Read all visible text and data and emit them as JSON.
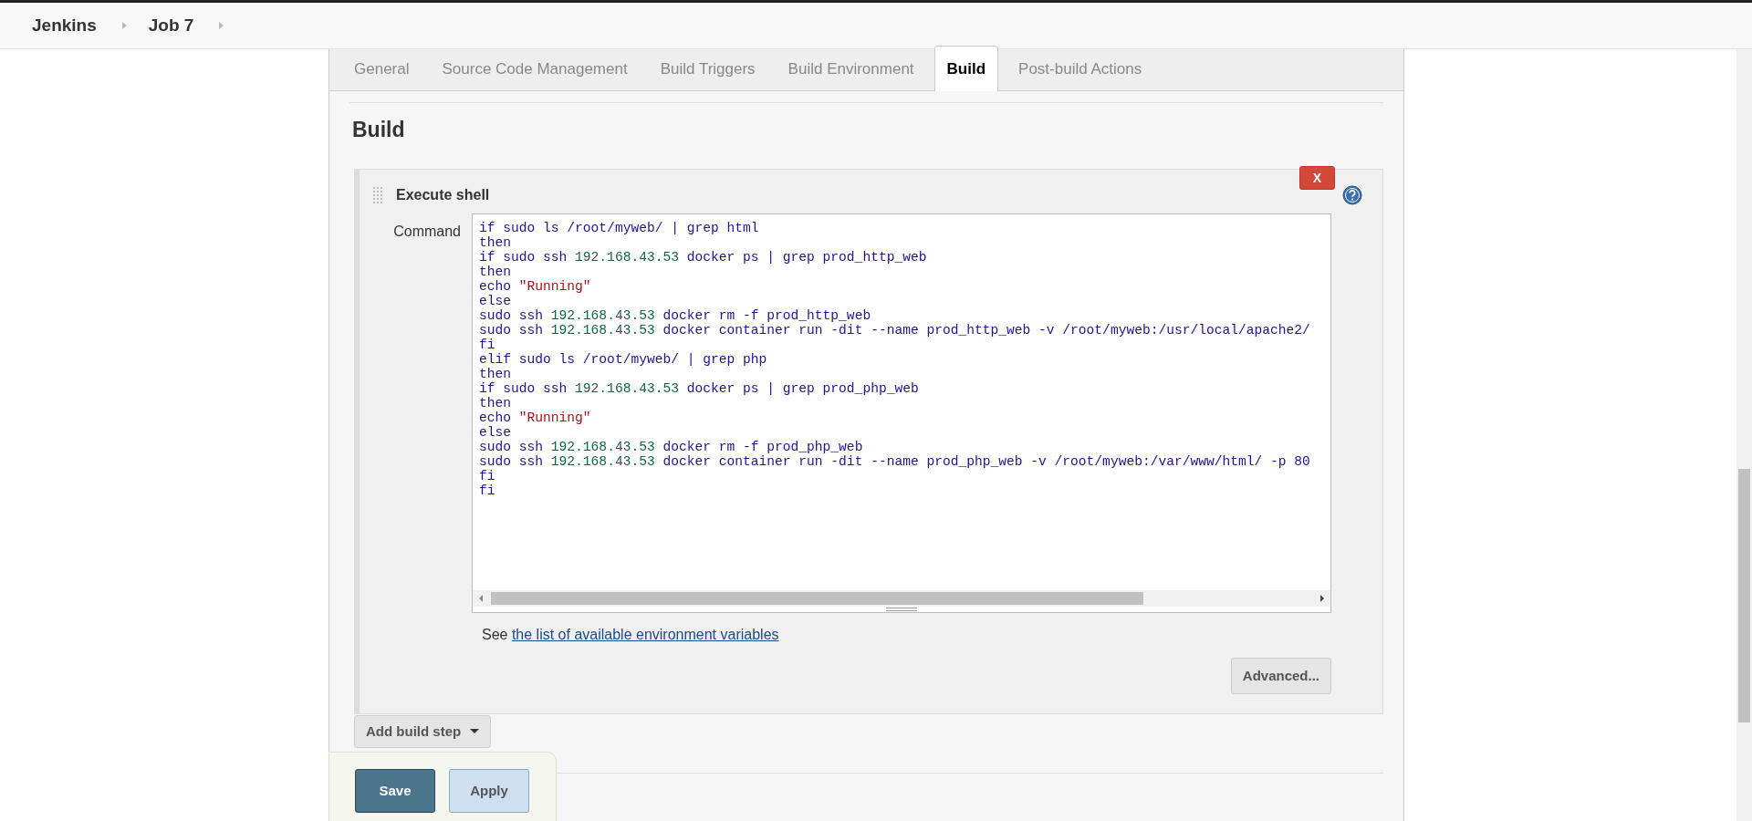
{
  "breadcrumbs": [
    {
      "label": "Jenkins"
    },
    {
      "label": "Job 7"
    }
  ],
  "tabs": [
    {
      "label": "General",
      "selected": false
    },
    {
      "label": "Source Code Management",
      "selected": false
    },
    {
      "label": "Build Triggers",
      "selected": false
    },
    {
      "label": "Build Environment",
      "selected": false
    },
    {
      "label": "Build",
      "selected": true
    },
    {
      "label": "Post-build Actions",
      "selected": false
    }
  ],
  "section_title": "Build",
  "build_step": {
    "title": "Execute shell",
    "delete_button": "X",
    "command_label": "Command",
    "command_lines": [
      "if sudo ls /root/myweb/ | grep html",
      "then",
      "if sudo ssh 192.168.43.53 docker ps | grep prod_http_web",
      "then",
      "echo \"Running\"",
      "else",
      "sudo ssh 192.168.43.53 docker rm -f prod_http_web",
      "sudo ssh 192.168.43.53 docker container run -dit --name prod_http_web -v /root/myweb:/usr/local/apache2/",
      "fi",
      "elif sudo ls /root/myweb/ | grep php",
      "then",
      "if sudo ssh 192.168.43.53 docker ps | grep prod_php_web",
      "then",
      "echo \"Running\"",
      "else",
      "sudo ssh 192.168.43.53 docker rm -f prod_php_web",
      "sudo ssh 192.168.43.53 docker container run -dit --name prod_php_web -v /root/myweb:/var/www/html/ -p 80",
      "fi",
      "fi"
    ],
    "help_text": "See",
    "help_link": "the list of available environment variables",
    "advanced_button": "Advanced..."
  },
  "add_build_step_button": "Add build step",
  "footer_buttons": [
    {
      "label": "Save",
      "kind": "primary"
    },
    {
      "label": "Apply",
      "kind": "secondary"
    }
  ]
}
